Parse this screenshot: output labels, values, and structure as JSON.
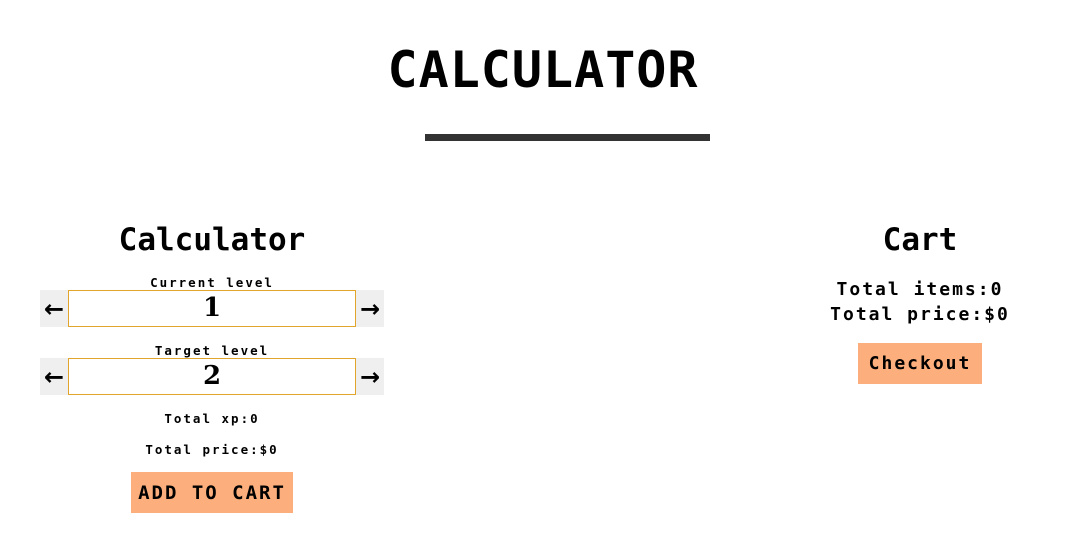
{
  "page": {
    "title": "CALCULATOR"
  },
  "calculator": {
    "heading": "Calculator",
    "current_level": {
      "label": "Current level",
      "value": "1",
      "left_arrow": "←",
      "right_arrow": "→"
    },
    "target_level": {
      "label": "Target level",
      "value": "2",
      "left_arrow": "←",
      "right_arrow": "→"
    },
    "total_xp": "Total xp:0",
    "total_price": "Total price:$0",
    "add_to_cart_label": "ADD TO CART"
  },
  "cart": {
    "heading": "Cart",
    "total_items": "Total items:0",
    "total_price": "Total price:$0",
    "checkout_label": "Checkout"
  },
  "colors": {
    "button_bg": "#fcaf7c",
    "input_border": "#e0a52a",
    "stepper_bg": "#efefef",
    "rule": "#333333"
  }
}
